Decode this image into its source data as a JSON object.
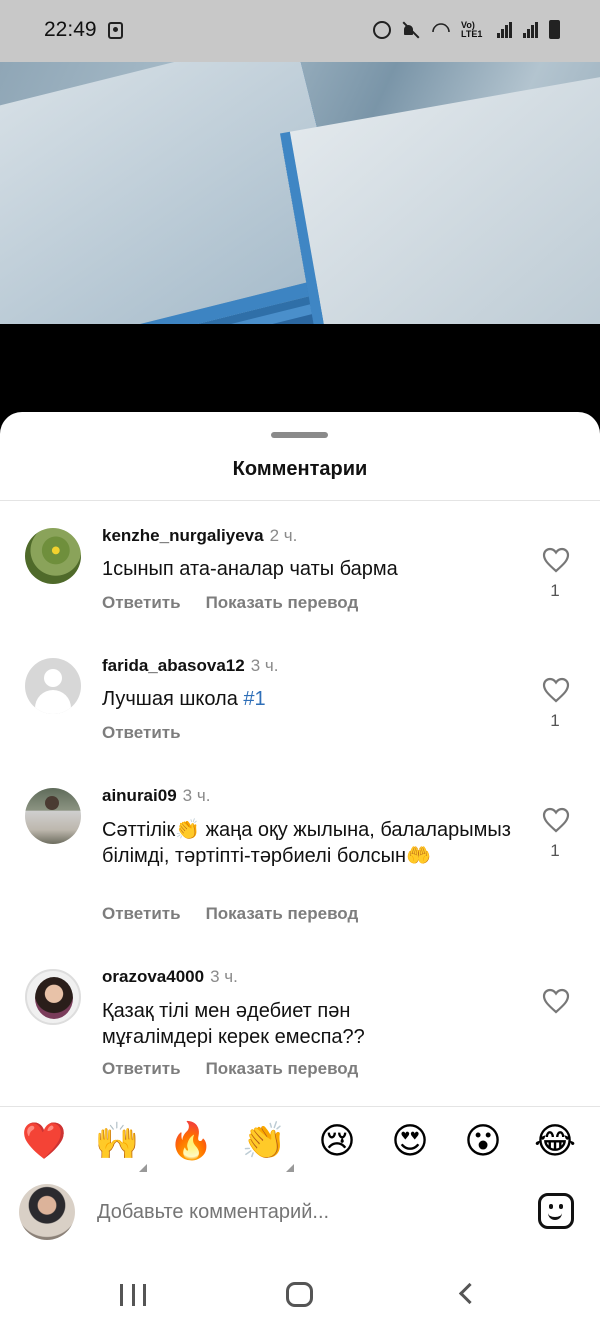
{
  "status_bar": {
    "time": "22:49",
    "lte_label": "Vo) LTE1"
  },
  "sheet": {
    "title": "Комментарии"
  },
  "comments": [
    {
      "username": "kenzhe_nurgaliyeva",
      "time": "2 ч.",
      "text": "1сынып ата-аналар чаты барма",
      "reply": "Ответить",
      "translate": "Показать перевод",
      "likes": "1"
    },
    {
      "username": "farida_abasova12",
      "time": "3 ч.",
      "text": "Лучшая школа ",
      "tag": "#1",
      "reply": "Ответить",
      "likes": "1"
    },
    {
      "username": "ainurai09",
      "time": "3 ч.",
      "text": "Сәттілік👏 жаңа оқу жылына, балаларымыз білімді, тәртіпті-тәрбиелі болсын🤲",
      "reply": "Ответить",
      "translate": "Показать перевод",
      "likes": "1"
    },
    {
      "username": "orazova4000",
      "time": "3 ч.",
      "text": "Қазақ  тілі мен әдебиет пән мұғалімдері керек емеспа??",
      "reply": "Ответить",
      "translate": "Показать перевод"
    }
  ],
  "emoji_bar": [
    "❤️",
    "🙌",
    "🔥",
    "👏",
    "😢",
    "😍",
    "😮",
    "😂"
  ],
  "composer": {
    "placeholder": "Добавьте комментарий..."
  },
  "colors": {
    "tag": "#2f6fb8",
    "secondary_text": "#7d7d7d",
    "sheet_bg": "#ffffff"
  }
}
